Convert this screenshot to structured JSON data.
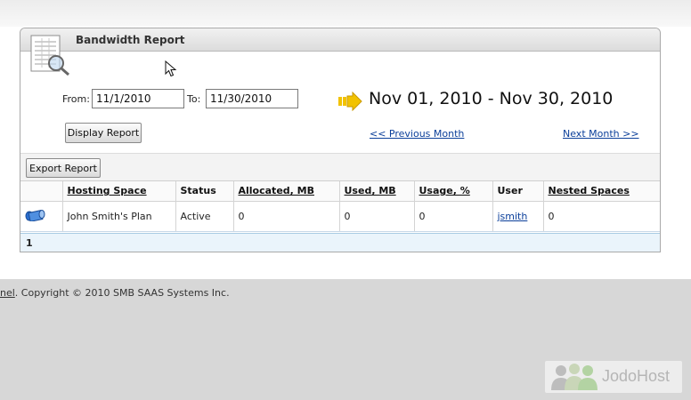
{
  "panel": {
    "title": "Bandwidth Report"
  },
  "filters": {
    "from_label": "From:",
    "from_value": "11/1/2010",
    "to_label": "To:",
    "to_value": "11/30/2010",
    "date_range": "Nov 01, 2010 - Nov 30, 2010",
    "display_button": "Display Report",
    "prev_link": "<< Previous Month",
    "next_link": "Next Month >>"
  },
  "toolbar": {
    "export_button": "Export Report"
  },
  "table": {
    "headers": [
      "",
      "Hosting Space",
      "Status",
      "Allocated, MB",
      "Used, MB",
      "Usage, %",
      "User",
      "Nested Spaces"
    ],
    "rows": [
      {
        "space": "John Smith's Plan",
        "status": "Active",
        "allocated": "0",
        "used": "0",
        "usage": "0",
        "user": "jsmith",
        "nested": "0"
      }
    ]
  },
  "pager": {
    "current_page": "1"
  },
  "footer": {
    "copyright_link": "nel",
    "copyright_text": ". Copyright © 2010 SMB SAAS Systems Inc."
  },
  "watermark": {
    "text": "JodoHost"
  },
  "colors": {
    "accent_arrow": "#f2c200",
    "link": "#0b3f9a",
    "footer_bg": "#d7d7d7"
  }
}
